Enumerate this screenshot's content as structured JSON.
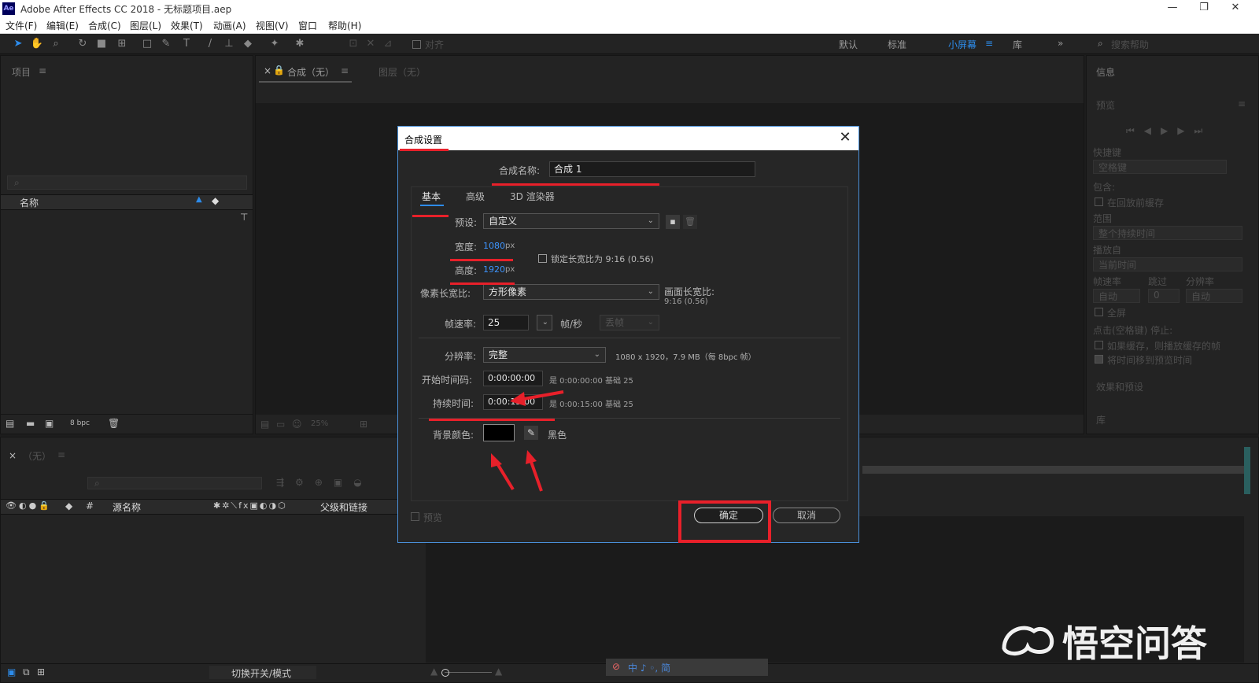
{
  "window": {
    "title": "Adobe After Effects CC 2018 - 无标题项目.aep",
    "app_badge": "Ae",
    "minimize": "—",
    "restore": "❐",
    "close": "✕"
  },
  "menu": [
    "文件(F)",
    "编辑(E)",
    "合成(C)",
    "图层(L)",
    "效果(T)",
    "动画(A)",
    "视图(V)",
    "窗口",
    "帮助(H)"
  ],
  "toolbar": {
    "align_label": "对齐",
    "workspaces": [
      "默认",
      "标准",
      "小屏幕",
      "库"
    ],
    "active_workspace": "小屏幕",
    "search_placeholder": "搜索帮助"
  },
  "project_panel": {
    "title": "项目",
    "column_name": "名称",
    "bpc": "8 bpc"
  },
  "comp_panel": {
    "tab_comp": "合成（无）",
    "tab_layer": "图层（无）",
    "zoom": "25%"
  },
  "right_panel": {
    "info": "信息",
    "preview": "预览",
    "shortcut_label": "快捷键",
    "shortcut_value": "空格键",
    "include_label": "包含:",
    "cache_before": "在回放前缓存",
    "range_label": "范围",
    "range_value": "整个持续时间",
    "play_from_label": "播放自",
    "play_from_value": "当前时间",
    "fps_label": "帧速率",
    "skip_label": "跳过",
    "res_label": "分辨率",
    "fps_value": "自动",
    "skip_value": "0",
    "res_value": "自动",
    "fullscreen": "全屏",
    "stop_label": "点击(空格键) 停止:",
    "opt1": "如果缓存，则播放缓存的帧",
    "opt2": "将时间移到预览时间",
    "effects": "效果和预设",
    "library": "库"
  },
  "timeline": {
    "tab": "（无）",
    "col_source": "源名称",
    "col_parent": "父级和链接",
    "switch_mode": "切换开关/模式"
  },
  "dialog": {
    "title": "合成设置",
    "name_label": "合成名称:",
    "name_value": "合成 1",
    "tabs": [
      "基本",
      "高级",
      "3D 渲染器"
    ],
    "preset_label": "预设:",
    "preset_value": "自定义",
    "width_label": "宽度:",
    "width_value": "1080",
    "height_label": "高度:",
    "height_value": "1920",
    "unit": "px",
    "lock_label": "锁定长宽比为 9:16 (0.56)",
    "par_label": "像素长宽比:",
    "par_value": "方形像素",
    "frame_aspect_label": "画面长宽比:",
    "frame_aspect_value": "9:16 (0.56)",
    "fps_label": "帧速率:",
    "fps_value": "25",
    "fps_unit": "帧/秒",
    "drop_frame": "丢帧",
    "res_label": "分辨率:",
    "res_value": "完整",
    "res_info": "1080 x 1920，7.9 MB（每 8bpc 帧）",
    "start_label": "开始时间码:",
    "start_value": "0:00:00:00",
    "start_info": "是 0:00:00:00  基础 25",
    "duration_label": "持续时间:",
    "duration_value": "0:00:15:00",
    "duration_info": "是 0:00:15:00  基础 25",
    "bg_label": "背景颜色:",
    "bg_name": "黑色",
    "bg_color": "#000000",
    "preview_label": "预览",
    "ok": "确定",
    "cancel": "取消"
  },
  "watermark": {
    "text": "悟空问答"
  },
  "taskbar": {
    "ime": "中 ♪ ◦, 简"
  },
  "annotation_color": "#e8202a"
}
